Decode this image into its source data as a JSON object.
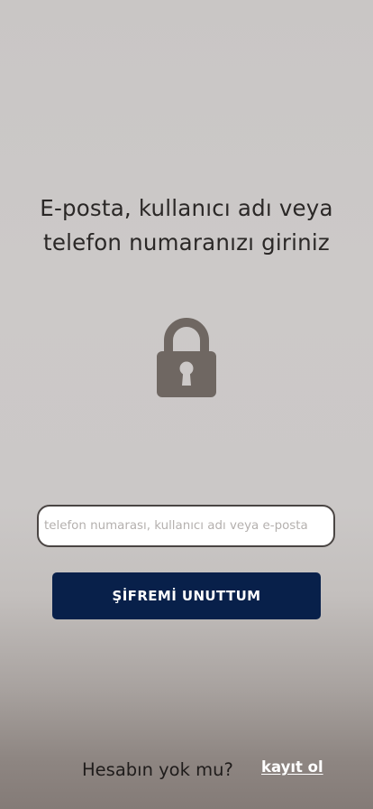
{
  "heading": {
    "line1": "E-posta, kullanıcı adı veya",
    "line2": "telefon numaranızı giriniz"
  },
  "lock": {
    "icon": "lock-icon",
    "color": "#6f6762"
  },
  "identifier_input": {
    "placeholder": "telefon numarası, kullanıcı adı veya e-posta",
    "value": ""
  },
  "forgot_button": {
    "label": "ŞİFREMİ UNUTTUM",
    "color": "#08204a"
  },
  "footer": {
    "prompt": "Hesabın yok mu?",
    "signup_link": "kayıt ol"
  }
}
